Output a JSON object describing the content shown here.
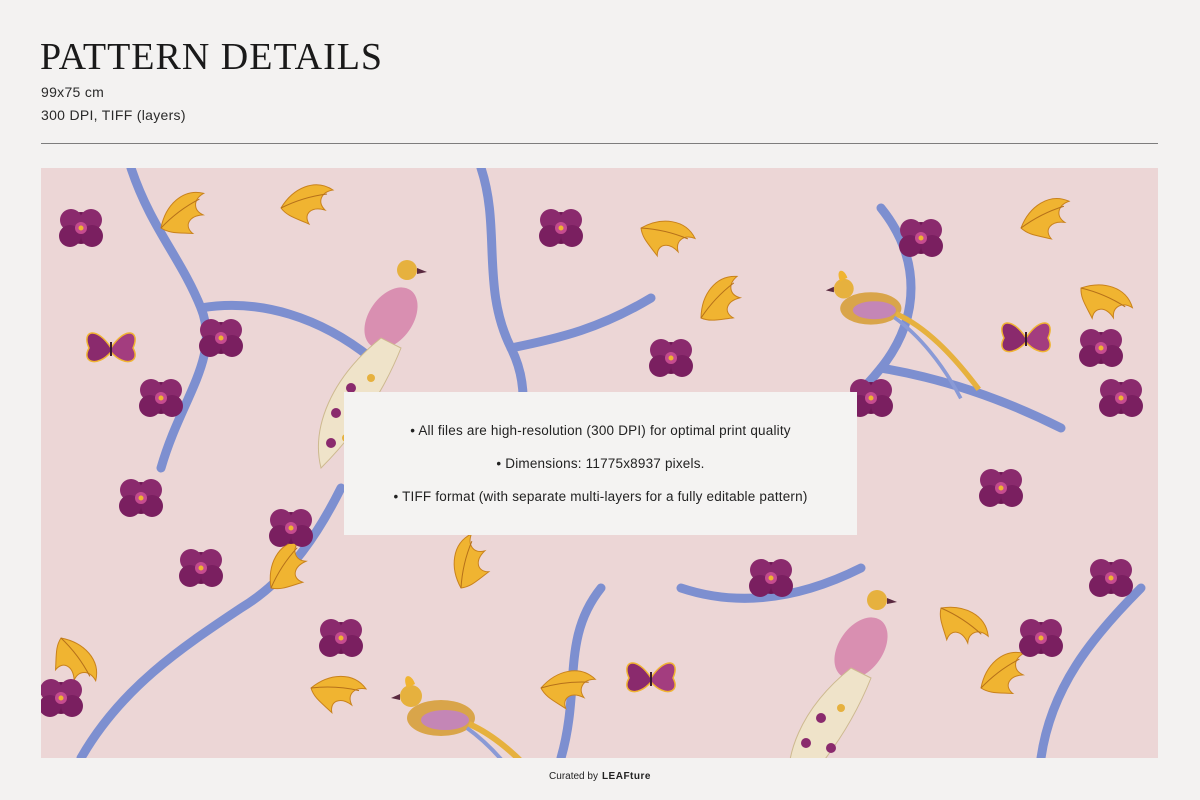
{
  "header": {
    "title": "PATTERN DETAILS",
    "size": "99x75 cm",
    "format": "300 DPI, TIFF (layers)"
  },
  "info_card": {
    "bullets": [
      "• All files are high-resolution (300 DPI) for optimal print quality",
      "• Dimensions: 11775x8937 pixels.",
      "• TIFF format (with separate multi-layers for a fully editable pattern)"
    ]
  },
  "footer": {
    "curated_label": "Curated by",
    "brand": "LEAFture"
  },
  "colors": {
    "page_bg": "#f3f2f1",
    "pattern_bg": "#ecd6d6",
    "branch": "#7d8fd0",
    "magenta_flower": "#7e1f5f",
    "gold_leaf": "#f0b431",
    "divider": "#7d7d7d"
  },
  "pattern": {
    "motifs": [
      "peacock",
      "pheasant",
      "peony",
      "acanthus-leaf",
      "butterfly",
      "branch"
    ]
  }
}
